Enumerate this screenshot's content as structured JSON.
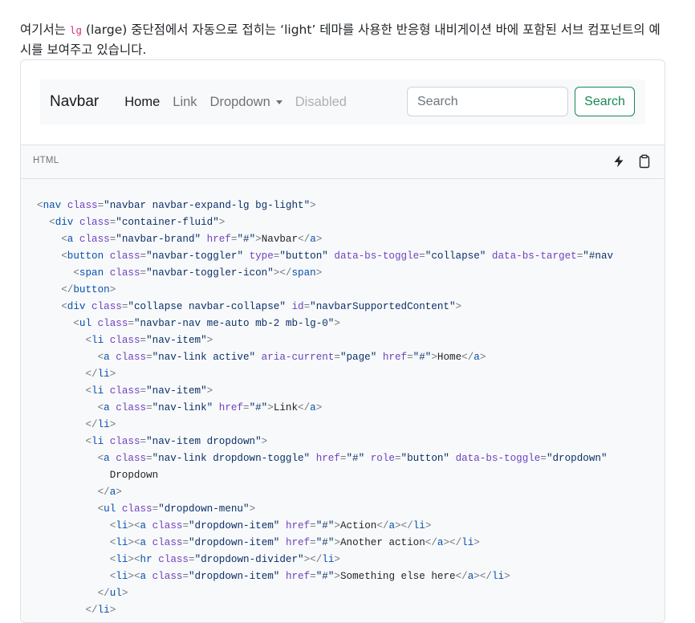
{
  "intro": {
    "before": "여기서는 ",
    "code": "lg",
    "after": " (large) 중단점에서 자동으로 접히는 ‘light’ 테마를 사용한 반응형 내비게이션 바에 포함된 서브 컴포넌트의 예시를 보여주고 있습니다."
  },
  "navbar": {
    "brand": "Navbar",
    "items": [
      {
        "label": "Home",
        "state": "active"
      },
      {
        "label": "Link",
        "state": "normal"
      },
      {
        "label": "Dropdown",
        "state": "dropdown"
      },
      {
        "label": "Disabled",
        "state": "disabled"
      }
    ],
    "search": {
      "placeholder": "Search",
      "button_label": "Search"
    }
  },
  "code_block": {
    "language": "HTML",
    "toolbar_icons": [
      "lightning-icon",
      "clipboard-icon"
    ],
    "lines": [
      "<nav class=\"navbar navbar-expand-lg bg-light\">",
      "  <div class=\"container-fluid\">",
      "    <a class=\"navbar-brand\" href=\"#\">Navbar</a>",
      "    <button class=\"navbar-toggler\" type=\"button\" data-bs-toggle=\"collapse\" data-bs-target=\"#nav",
      "      <span class=\"navbar-toggler-icon\"></span>",
      "    </button>",
      "    <div class=\"collapse navbar-collapse\" id=\"navbarSupportedContent\">",
      "      <ul class=\"navbar-nav me-auto mb-2 mb-lg-0\">",
      "        <li class=\"nav-item\">",
      "          <a class=\"nav-link active\" aria-current=\"page\" href=\"#\">Home</a>",
      "        </li>",
      "        <li class=\"nav-item\">",
      "          <a class=\"nav-link\" href=\"#\">Link</a>",
      "        </li>",
      "        <li class=\"nav-item dropdown\">",
      "          <a class=\"nav-link dropdown-toggle\" href=\"#\" role=\"button\" data-bs-toggle=\"dropdown\"",
      "            Dropdown",
      "          </a>",
      "          <ul class=\"dropdown-menu\">",
      "            <li><a class=\"dropdown-item\" href=\"#\">Action</a></li>",
      "            <li><a class=\"dropdown-item\" href=\"#\">Another action</a></li>",
      "            <li><hr class=\"dropdown-divider\"></li>",
      "            <li><a class=\"dropdown-item\" href=\"#\">Something else here</a></li>",
      "          </ul>",
      "        </li>"
    ]
  }
}
